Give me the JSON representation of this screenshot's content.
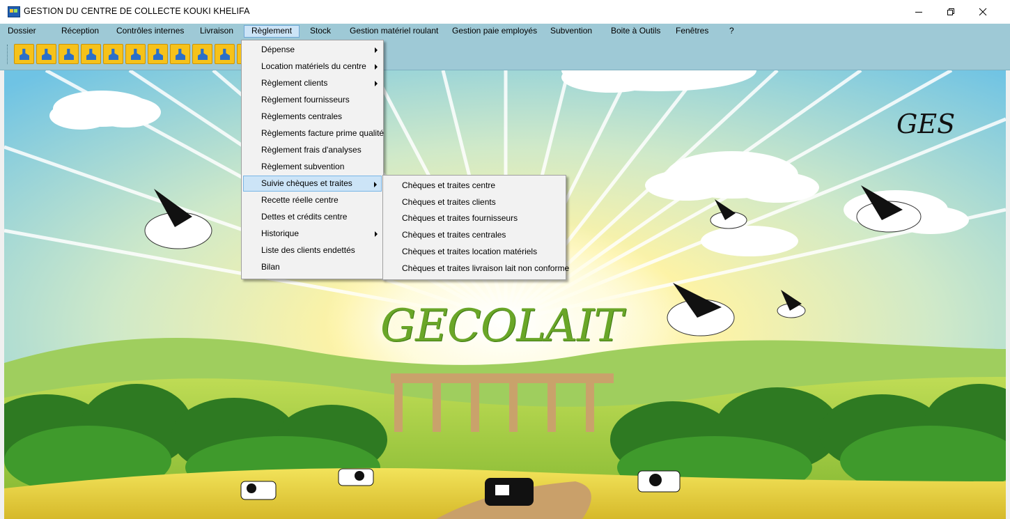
{
  "window": {
    "title": "GESTION  DU CENTRE DE COLLECTE KOUKI KHELIFA",
    "controls": [
      "minimize-icon",
      "restore-icon",
      "close-icon"
    ]
  },
  "menubar": {
    "items": [
      {
        "label": "Dossier"
      },
      {
        "label": "Réception"
      },
      {
        "label": "Contrôles internes"
      },
      {
        "label": "Livraison"
      },
      {
        "label": "Règlement",
        "active": true
      },
      {
        "label": "Stock"
      },
      {
        "label": "Gestion matériel roulant"
      },
      {
        "label": "Gestion paie employés"
      },
      {
        "label": "Subvention"
      },
      {
        "label": "Boite à Outils"
      },
      {
        "label": "Fenêtres"
      },
      {
        "label": "?"
      }
    ]
  },
  "toolbar": {
    "buttons": [
      "toolbar-button-1",
      "toolbar-button-2",
      "toolbar-button-3",
      "toolbar-button-4",
      "toolbar-button-5",
      "toolbar-button-6",
      "toolbar-button-7",
      "toolbar-button-8",
      "toolbar-button-9",
      "toolbar-button-10",
      "toolbar-button-11"
    ]
  },
  "reglement_menu": {
    "items": [
      {
        "label": "Dépense",
        "submenu": true
      },
      {
        "label": "Location matériels du centre",
        "submenu": true
      },
      {
        "label": "Règlement clients",
        "submenu": true
      },
      {
        "label": "Règlement fournisseurs",
        "submenu": false
      },
      {
        "label": "Règlements centrales",
        "submenu": false
      },
      {
        "label": "Règlements facture prime qualité",
        "submenu": false
      },
      {
        "label": "Règlement frais d'analyses",
        "submenu": false
      },
      {
        "label": "Règlement subvention",
        "submenu": false
      },
      {
        "label": "Suivie chèques et traites",
        "submenu": true,
        "hover": true
      },
      {
        "label": "Recette réelle centre",
        "submenu": false
      },
      {
        "label": "Dettes et crédits centre",
        "submenu": false
      },
      {
        "label": "Historique",
        "submenu": true
      },
      {
        "label": "Liste des clients endettés",
        "submenu": false
      },
      {
        "label": "Bilan",
        "submenu": false
      }
    ]
  },
  "cheques_submenu": {
    "items": [
      "Chèques et traites centre",
      "Chèques et traites clients",
      "Chèques et traites fournisseurs",
      "Chèques et traites centrales",
      "Chèques et traites location matériels",
      "Chèques et traites livraison lait non conforme"
    ]
  },
  "background": {
    "logo_text": "GECOLAIT",
    "corner_text": "GES"
  },
  "colors": {
    "menubar": "#9ec9d6",
    "menu_hover": "#cce4f7",
    "toolbar_button": "#f6c21a",
    "logo_green": "#6aa628"
  }
}
